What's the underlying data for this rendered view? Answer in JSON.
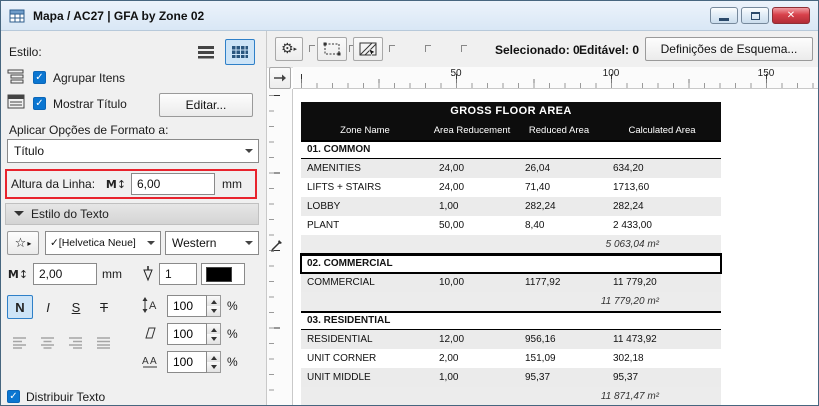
{
  "window": {
    "title": "Mapa / AC27 | GFA by Zone 02"
  },
  "icons": {
    "gear": "⚙",
    "star": "☆",
    "check": "✓",
    "close": "✕",
    "m_height": "M",
    "arrow_updown": "↕",
    "arrow_small": "▸"
  },
  "left_panel": {
    "estilo_label": "Estilo:",
    "agrupar_label": "Agrupar Itens",
    "mostrar_label": "Mostrar Título",
    "editar_button": "Editar...",
    "aplicar_label": "Aplicar Opções de Formato a:",
    "formato_value": "Título",
    "altura_label": "Altura da Linha:",
    "altura_value": "6,00",
    "altura_unit": "mm",
    "texto_section": "Estilo do Texto",
    "font_value": "✓[Helvetica Neue]",
    "script_value": "Western",
    "size_value": "2,00",
    "size_unit": "mm",
    "pen_value": "1",
    "bold_label": "N",
    "italic_label": "I",
    "underline_label": "S",
    "strike_label": "T",
    "spacing_rows": [
      {
        "value": "100",
        "unit": "%"
      },
      {
        "value": "100",
        "unit": "%"
      },
      {
        "value": "100",
        "unit": "%"
      }
    ],
    "distribuir_label": "Distribuir Texto"
  },
  "toolbar": {
    "selected_label": "Selecionado: 0",
    "editable_label": "Editável: 0",
    "scheme_button": "Definições de Esquema..."
  },
  "ruler": {
    "h_marks": [
      "50",
      "100",
      "150"
    ]
  },
  "table": {
    "title": "GROSS FLOOR AREA",
    "columns": [
      "Zone Name",
      "Area Reducement",
      "Reduced Area",
      "Calculated Area"
    ],
    "groups": [
      {
        "name": "01. COMMON",
        "selected": false,
        "rows": [
          [
            "AMENITIES",
            "24,00",
            "26,04",
            "634,20"
          ],
          [
            "LIFTS + STAIRS",
            "24,00",
            "71,40",
            "1713,60"
          ],
          [
            "LOBBY",
            "1,00",
            "282,24",
            "282,24"
          ],
          [
            "PLANT",
            "50,00",
            "8,40",
            "2 433,00"
          ]
        ],
        "subtotal": "5 063,04 m²"
      },
      {
        "name": "02. COMMERCIAL",
        "selected": true,
        "rows": [
          [
            "COMMERCIAL",
            "10,00",
            "1177,92",
            "11 779,20"
          ]
        ],
        "subtotal": "11 779,20 m²"
      },
      {
        "name": "03. RESIDENTIAL",
        "selected": false,
        "rows": [
          [
            "RESIDENTIAL",
            "12,00",
            "956,16",
            "11 473,92"
          ],
          [
            "UNIT CORNER",
            "2,00",
            "151,09",
            "302,18"
          ],
          [
            "UNIT MIDDLE",
            "1,00",
            "95,37",
            "95,37"
          ]
        ],
        "subtotal": "11 871,47 m²"
      }
    ]
  }
}
